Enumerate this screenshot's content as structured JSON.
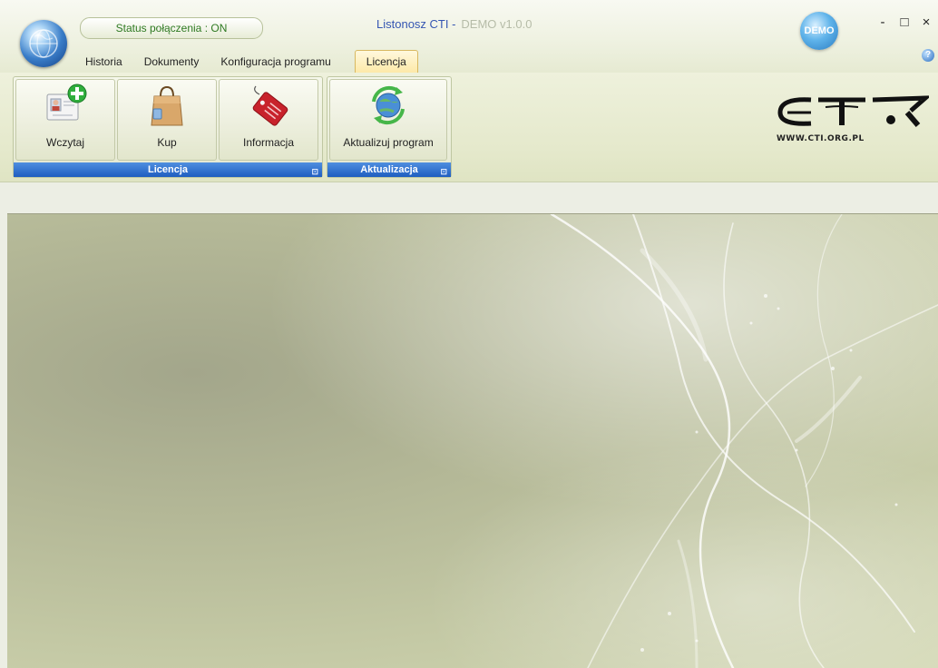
{
  "window": {
    "status": "Status połączenia : ON",
    "title": "Listonosz CTI -",
    "version": "DEMO v1.0.0",
    "demo_badge": "DEMO",
    "controls": {
      "minimize": "-",
      "maximize": "□",
      "close": "×"
    }
  },
  "tabs": [
    {
      "label": "Historia"
    },
    {
      "label": "Dokumenty"
    },
    {
      "label": "Konfiguracja programu"
    },
    {
      "label": "Licencja",
      "active": true
    }
  ],
  "help_icon": "?",
  "ribbon": {
    "groups": [
      {
        "label": "Licencja",
        "buttons": [
          {
            "label": "Wczytaj",
            "icon": "add-license-icon"
          },
          {
            "label": "Kup",
            "icon": "shopping-bag-icon"
          },
          {
            "label": "Informacja",
            "icon": "price-tag-icon"
          }
        ]
      },
      {
        "label": "Aktualizacja",
        "buttons": [
          {
            "label": "Aktualizuj program",
            "icon": "refresh-globe-icon"
          }
        ]
      }
    ],
    "launcher": "⊡"
  },
  "logo": {
    "url": "WWW.CTI.ORG.PL"
  },
  "colors": {
    "status_text": "#2f7a22",
    "title_text": "#3556b2",
    "group_label_bg": "#1e5dc0",
    "active_tab": "#fde9a8"
  }
}
